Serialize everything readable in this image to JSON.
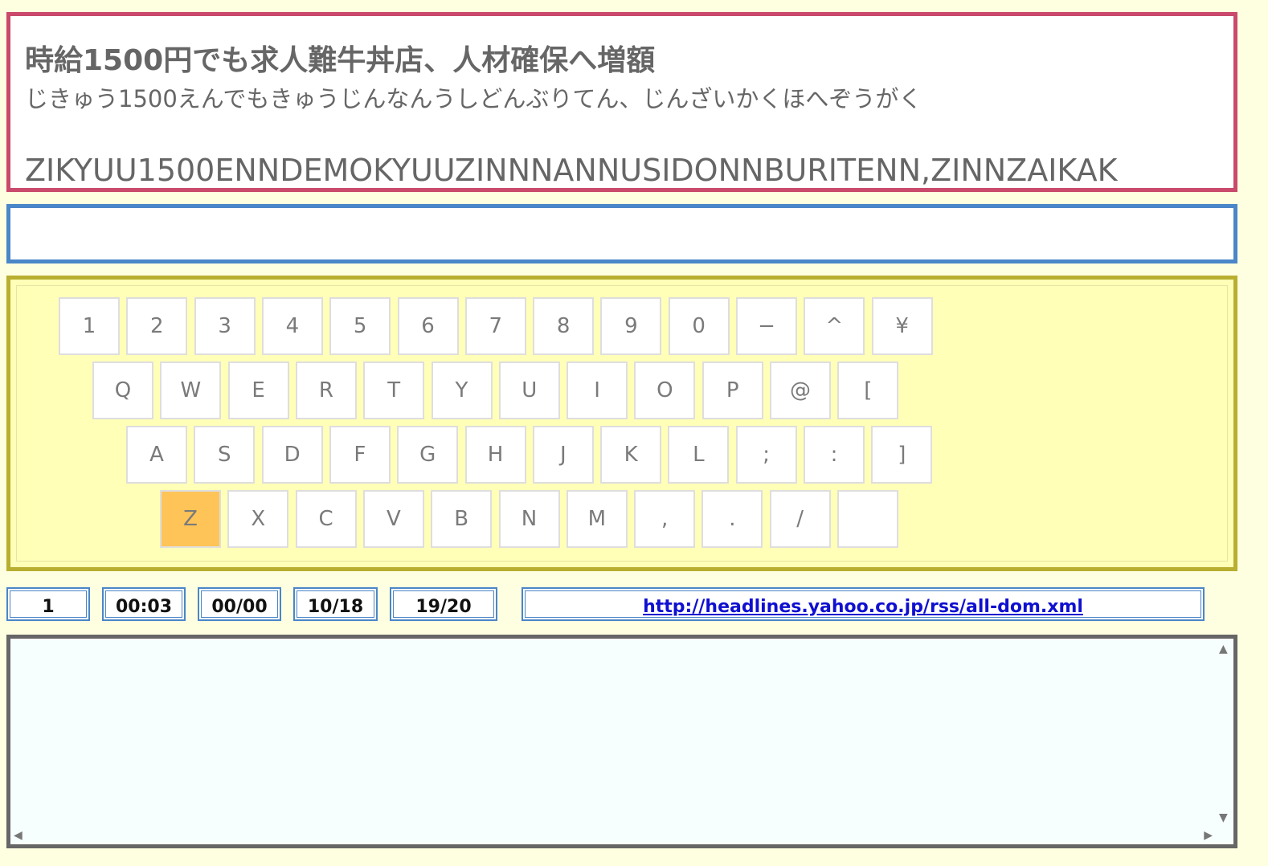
{
  "headline": {
    "kanji": "時給1500円でも求人難牛丼店、人材確保へ増額",
    "kana": "じきゅう1500えんでもきゅうじんなんうしどんぶりてん、じんざいかくほへぞうがく",
    "romaji": "ZIKYUU1500ENNDEMOKYUUZINNNANNUSIDONNBURITENN,ZINNZAIKAK"
  },
  "typed_input": "",
  "keyboard": {
    "highlight_key": "Z",
    "highlight_color": "#ffc457",
    "row1": [
      "1",
      "2",
      "3",
      "4",
      "5",
      "6",
      "7",
      "8",
      "9",
      "0",
      "−",
      "^",
      "¥"
    ],
    "row2": [
      "Q",
      "W",
      "E",
      "R",
      "T",
      "Y",
      "U",
      "I",
      "O",
      "P",
      "@",
      "["
    ],
    "row3": [
      "A",
      "S",
      "D",
      "F",
      "G",
      "H",
      "J",
      "K",
      "L",
      ";",
      ":",
      "]"
    ],
    "row4": [
      "Z",
      "X",
      "C",
      "V",
      "B",
      "N",
      "M",
      ",",
      ".",
      "/",
      ""
    ]
  },
  "stats": {
    "count": "1",
    "time": "00:03",
    "misses": "00/00",
    "progress": "10/18",
    "articles": "19/20",
    "feed_url": "http://headlines.yahoo.co.jp/rss/all-dom.xml"
  },
  "log_text": "",
  "colors": {
    "headline_border": "#c94a6c",
    "input_border": "#4a86c8",
    "keyboard_border": "#b8ae30",
    "keyboard_bg": "#ffffb8",
    "log_border": "#666666"
  }
}
